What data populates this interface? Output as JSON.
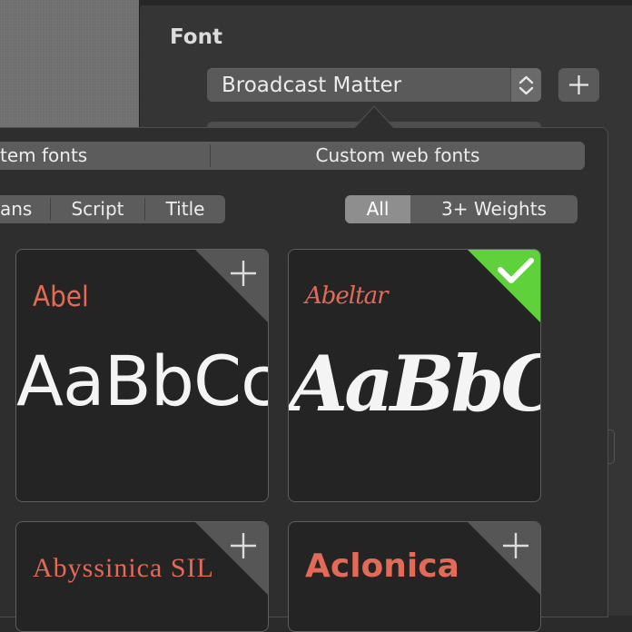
{
  "inspector": {
    "font_heading": "Font",
    "font_select": {
      "value": "Broadcast Matter"
    }
  },
  "source_tabs": [
    "tem fonts",
    "Custom web fonts"
  ],
  "category_filter": [
    "ans",
    "Script",
    "Title"
  ],
  "weight_filter": {
    "options": [
      "All",
      "3+ Weights"
    ],
    "selected": "All"
  },
  "font_cards": [
    {
      "name": "Abel",
      "sample": "AaBbCc",
      "selected": false
    },
    {
      "name": "Abeltar",
      "sample": "AaBbCc",
      "selected": true
    },
    {
      "name": "Abyssinica SIL",
      "sample": "",
      "selected": false
    },
    {
      "name": "Aclonica",
      "sample": "",
      "selected": false
    }
  ],
  "colors": {
    "name_accent": "#e36a57",
    "selected_badge": "#5fd13b",
    "panel": "#353535",
    "popover": "#2e2e2e"
  },
  "icons": [
    "plus-icon",
    "stepper-icon",
    "checkmark-icon"
  ]
}
